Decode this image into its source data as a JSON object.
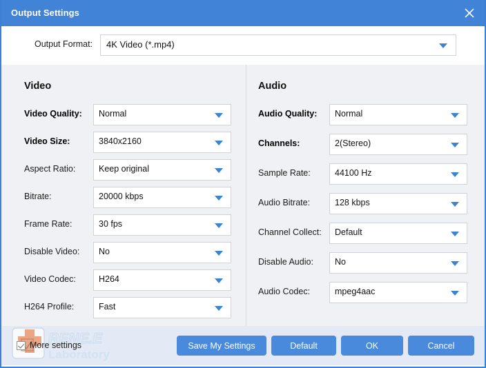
{
  "window": {
    "title": "Output Settings",
    "close_icon": "close-icon",
    "accent_color": "#4183d7",
    "panel_bg": "#f0f1f4",
    "footer_bg": "#e3e9f5",
    "button_color": "#4a8adc",
    "dropdown_arrow_color": "#3d83d4"
  },
  "output_format": {
    "label": "Output Format:",
    "value": "4K Video (*.mp4)",
    "arrow_icon": "chevron-down-icon"
  },
  "video": {
    "title": "Video",
    "rows": [
      {
        "label": "Video Quality:",
        "value": "Normal",
        "bold": true
      },
      {
        "label": "Video Size:",
        "value": "3840x2160",
        "bold": true
      },
      {
        "label": "Aspect Ratio:",
        "value": "Keep original",
        "bold": false
      },
      {
        "label": "Bitrate:",
        "value": "20000 kbps",
        "bold": false
      },
      {
        "label": "Frame Rate:",
        "value": "30 fps",
        "bold": false
      },
      {
        "label": "Disable Video:",
        "value": "No",
        "bold": false
      },
      {
        "label": "Video Codec:",
        "value": "H264",
        "bold": false
      },
      {
        "label": "H264 Profile:",
        "value": "Fast",
        "bold": false
      }
    ]
  },
  "audio": {
    "title": "Audio",
    "rows": [
      {
        "label": "Audio Quality:",
        "value": "Normal",
        "bold": true
      },
      {
        "label": "Channels:",
        "value": "2(Stereo)",
        "bold": true
      },
      {
        "label": "Sample Rate:",
        "value": "44100 Hz",
        "bold": false
      },
      {
        "label": "Audio Bitrate:",
        "value": "128 kbps",
        "bold": false
      },
      {
        "label": "Channel Collect:",
        "value": "Default",
        "bold": false
      },
      {
        "label": "Disable Audio:",
        "value": "No",
        "bold": false
      },
      {
        "label": "Audio Codec:",
        "value": "mpeg4aac",
        "bold": false
      }
    ]
  },
  "footer": {
    "more_settings_label": "More settings",
    "more_settings_checked": true,
    "save_label": "Save My Settings",
    "default_label": "Default",
    "ok_label": "OK",
    "cancel_label": "Cancel"
  },
  "watermark": {
    "line1": "RENE.E",
    "line2": "Laboratory"
  }
}
